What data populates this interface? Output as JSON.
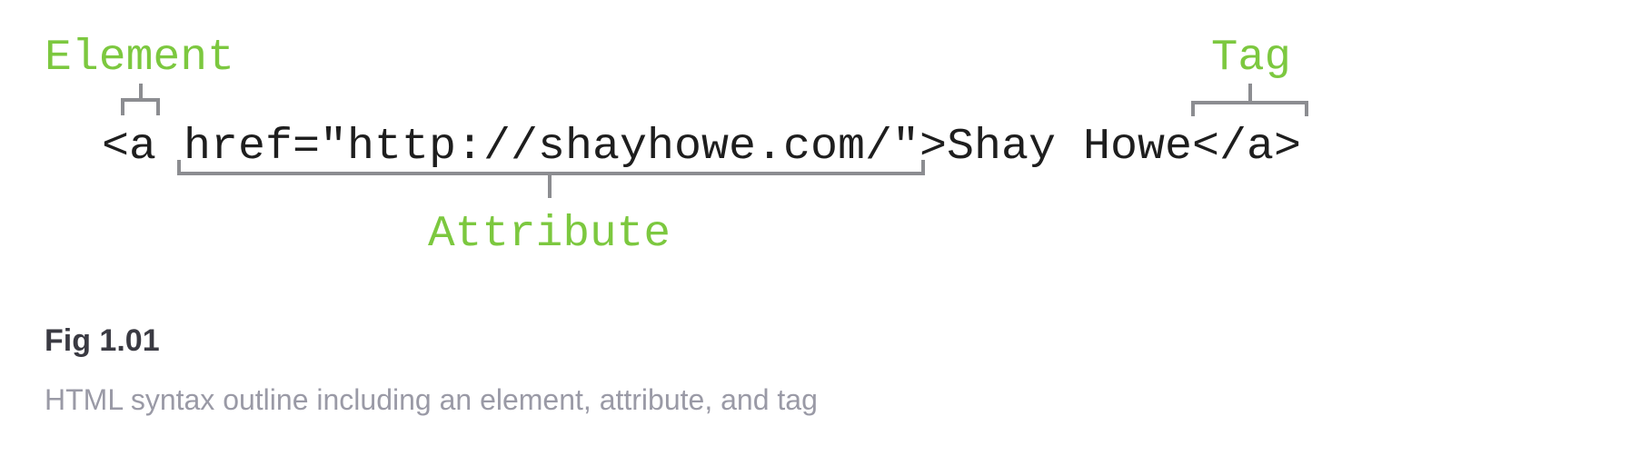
{
  "diagram": {
    "code": "<a href=\"http://shayhowe.com/\">Shay Howe</a>",
    "labels": {
      "element": "Element",
      "attribute": "Attribute",
      "tag": "Tag"
    },
    "colors": {
      "label": "#7cc83f",
      "bracket": "#8c8d91",
      "code": "#1e1e1e"
    }
  },
  "figure": {
    "number": "Fig 1.01",
    "caption": "HTML syntax outline including an element, attribute, and tag"
  }
}
